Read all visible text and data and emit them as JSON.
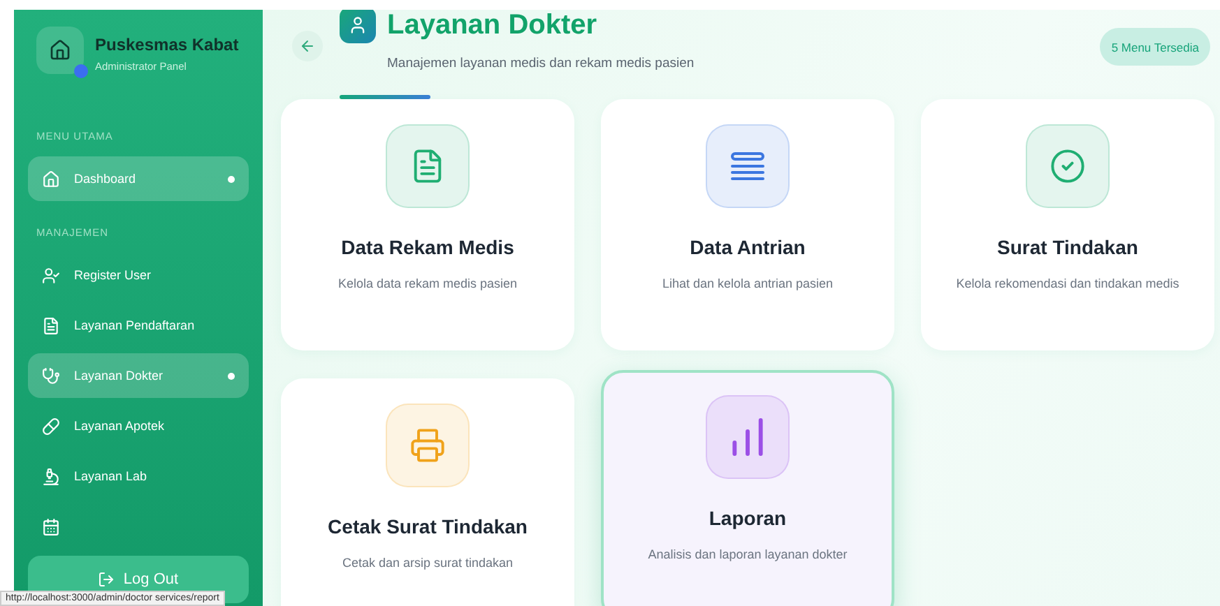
{
  "sidebar": {
    "title": "Puskesmas Kabat",
    "subtitle": "Administrator Panel",
    "sections": [
      {
        "heading": "MENU UTAMA",
        "items": [
          {
            "label": "Dashboard",
            "selected": true
          }
        ]
      },
      {
        "heading": "MANAJEMEN",
        "items": [
          {
            "label": "Register User",
            "selected": false
          },
          {
            "label": "Layanan Pendaftaran",
            "selected": false
          },
          {
            "label": "Layanan Dokter",
            "selected": true
          },
          {
            "label": "Layanan Apotek",
            "selected": false
          },
          {
            "label": "Layanan Lab",
            "selected": false
          }
        ]
      }
    ],
    "logout": "Log Out"
  },
  "header": {
    "title": "Layanan Dokter",
    "subtitle": "Manajemen layanan medis dan rekam medis pasien",
    "badge": "5 Menu Tersedia"
  },
  "cards": [
    {
      "title": "Data Rekam Medis",
      "description": "Kelola data rekam medis pasien",
      "color": "#1fae72",
      "highlighted": false
    },
    {
      "title": "Data Antrian",
      "description": "Lihat dan kelola antrian pasien",
      "color": "#3b76e0",
      "highlighted": false
    },
    {
      "title": "Surat Tindakan",
      "description": "Kelola rekomendasi dan tindakan medis",
      "color": "#1fae72",
      "highlighted": false
    },
    {
      "title": "Cetak Surat Tindakan",
      "description": "Cetak dan arsip surat tindakan",
      "color": "#f0a21a",
      "highlighted": false
    },
    {
      "title": "Laporan",
      "description": "Analisis dan laporan layanan dokter",
      "color": "#9b4fe6",
      "highlighted": true
    }
  ],
  "status_url": "http://localhost:3000/admin/doctor services/report"
}
